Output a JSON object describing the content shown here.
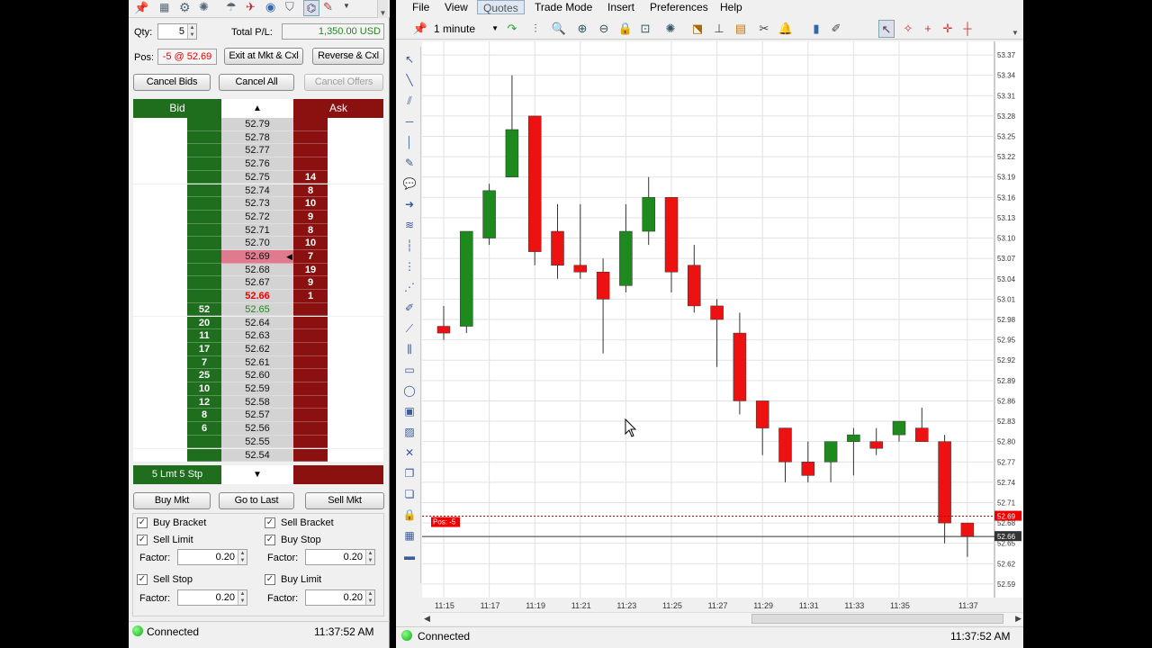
{
  "dom": {
    "qty_label": "Qty:",
    "qty_value": "5",
    "total_pl_label": "Total P/L:",
    "total_pl_value": "1,350.00 USD",
    "pos_label": "Pos:",
    "pos_value": "-5 @ 52.69",
    "btn_exit": "Exit at Mkt & Cxl",
    "btn_reverse": "Reverse & Cxl",
    "btn_cancel_bids": "Cancel Bids",
    "btn_cancel_all": "Cancel All",
    "btn_cancel_offers": "Cancel Offers",
    "hdr_bid": "Bid",
    "hdr_ask": "Ask",
    "footer_bid": "5 Lmt 5 Stp",
    "btn_buy_mkt": "Buy Mkt",
    "btn_go_last": "Go to Last",
    "btn_sell_mkt": "Sell Mkt",
    "opt_buy_bracket": "Buy Bracket",
    "opt_sell_limit": "Sell Limit",
    "opt_sell_bracket": "Sell Bracket",
    "opt_buy_stop": "Buy Stop",
    "opt_sell_stop": "Sell Stop",
    "opt_buy_limit": "Buy Limit",
    "factor_label": "Factor:",
    "factor_value": "0.20",
    "status": "Connected",
    "time": "11:37:52 AM",
    "rows": [
      {
        "price": "52.79",
        "bid": "",
        "ask": ""
      },
      {
        "price": "52.78",
        "bid": "",
        "ask": ""
      },
      {
        "price": "52.77",
        "bid": "",
        "ask": ""
      },
      {
        "price": "52.76",
        "bid": "",
        "ask": ""
      },
      {
        "price": "52.75",
        "bid": "",
        "ask": "14"
      },
      {
        "price": "52.74",
        "bid": "",
        "ask": "8"
      },
      {
        "price": "52.73",
        "bid": "",
        "ask": "10"
      },
      {
        "price": "52.72",
        "bid": "",
        "ask": "9"
      },
      {
        "price": "52.71",
        "bid": "",
        "ask": "8"
      },
      {
        "price": "52.70",
        "bid": "",
        "ask": "10"
      },
      {
        "price": "52.69",
        "bid": "",
        "ask": "7",
        "pos": true
      },
      {
        "price": "52.68",
        "bid": "",
        "ask": "19"
      },
      {
        "price": "52.67",
        "bid": "",
        "ask": "9"
      },
      {
        "price": "52.66",
        "bid": "",
        "ask": "1",
        "last": "down"
      },
      {
        "price": "52.65",
        "bid": "52",
        "ask": "",
        "last": "up"
      },
      {
        "price": "52.64",
        "bid": "20",
        "ask": ""
      },
      {
        "price": "52.63",
        "bid": "11",
        "ask": ""
      },
      {
        "price": "52.62",
        "bid": "17",
        "ask": ""
      },
      {
        "price": "52.61",
        "bid": "7",
        "ask": ""
      },
      {
        "price": "52.60",
        "bid": "25",
        "ask": ""
      },
      {
        "price": "52.59",
        "bid": "10",
        "ask": ""
      },
      {
        "price": "52.58",
        "bid": "12",
        "ask": ""
      },
      {
        "price": "52.57",
        "bid": "8",
        "ask": ""
      },
      {
        "price": "52.56",
        "bid": "6",
        "ask": ""
      },
      {
        "price": "52.55",
        "bid": "",
        "ask": ""
      },
      {
        "price": "52.54",
        "bid": "",
        "ask": ""
      }
    ]
  },
  "chart": {
    "menu": [
      "File",
      "View",
      "Quotes",
      "Trade Mode",
      "Insert",
      "Preferences",
      "Help"
    ],
    "active_menu": "Quotes",
    "interval": "1 minute",
    "status": "Connected",
    "time": "11:37:52 AM",
    "pos_tag": "Pos: -5",
    "pos_price": "52.69",
    "last_price": "52.66"
  },
  "chart_data": {
    "type": "candlestick",
    "x_labels": [
      "11:15",
      "11:17",
      "11:19",
      "11:21",
      "11:23",
      "11:25",
      "11:27",
      "11:29",
      "11:31",
      "11:33",
      "11:35",
      "11:37"
    ],
    "y_ticks": [
      "53.37",
      "53.34",
      "53.31",
      "53.28",
      "53.25",
      "53.22",
      "53.19",
      "53.16",
      "53.13",
      "53.10",
      "53.07",
      "53.04",
      "53.01",
      "52.98",
      "52.95",
      "52.92",
      "52.89",
      "52.86",
      "52.83",
      "52.80",
      "52.77",
      "52.74",
      "52.71",
      "52.68",
      "52.65",
      "52.62",
      "52.59"
    ],
    "ylim": [
      52.57,
      53.39
    ],
    "candles": [
      {
        "t": "11:15",
        "o": 52.97,
        "h": 53.0,
        "l": 52.95,
        "c": 52.96
      },
      {
        "t": "11:16",
        "o": 52.97,
        "h": 53.1,
        "l": 52.96,
        "c": 53.11
      },
      {
        "t": "11:17",
        "o": 53.1,
        "h": 53.18,
        "l": 53.09,
        "c": 53.17
      },
      {
        "t": "11:17",
        "o": 53.19,
        "h": 53.34,
        "l": 53.19,
        "c": 53.26
      },
      {
        "t": "11:18",
        "o": 53.28,
        "h": 53.28,
        "l": 53.06,
        "c": 53.08
      },
      {
        "t": "11:19",
        "o": 53.11,
        "h": 53.15,
        "l": 53.04,
        "c": 53.06
      },
      {
        "t": "11:20",
        "o": 53.06,
        "h": 53.15,
        "l": 53.04,
        "c": 53.05
      },
      {
        "t": "11:21",
        "o": 53.05,
        "h": 53.07,
        "l": 52.93,
        "c": 53.01
      },
      {
        "t": "11:22",
        "o": 53.03,
        "h": 53.15,
        "l": 53.02,
        "c": 53.11
      },
      {
        "t": "11:23",
        "o": 53.11,
        "h": 53.19,
        "l": 53.09,
        "c": 53.16
      },
      {
        "t": "11:24",
        "o": 53.16,
        "h": 53.16,
        "l": 53.02,
        "c": 53.05
      },
      {
        "t": "11:25",
        "o": 53.06,
        "h": 53.09,
        "l": 52.99,
        "c": 53.0
      },
      {
        "t": "11:26",
        "o": 53.0,
        "h": 53.01,
        "l": 52.91,
        "c": 52.98
      },
      {
        "t": "11:27",
        "o": 52.96,
        "h": 52.99,
        "l": 52.84,
        "c": 52.86
      },
      {
        "t": "11:28",
        "o": 52.86,
        "h": 52.86,
        "l": 52.78,
        "c": 52.82
      },
      {
        "t": "11:29",
        "o": 52.82,
        "h": 52.82,
        "l": 52.74,
        "c": 52.77
      },
      {
        "t": "11:30",
        "o": 52.77,
        "h": 52.8,
        "l": 52.74,
        "c": 52.75
      },
      {
        "t": "11:31",
        "o": 52.77,
        "h": 52.8,
        "l": 52.74,
        "c": 52.8
      },
      {
        "t": "11:32",
        "o": 52.8,
        "h": 52.82,
        "l": 52.75,
        "c": 52.81
      },
      {
        "t": "11:33",
        "o": 52.8,
        "h": 52.82,
        "l": 52.78,
        "c": 52.79
      },
      {
        "t": "11:34",
        "o": 52.81,
        "h": 52.83,
        "l": 52.8,
        "c": 52.83
      },
      {
        "t": "11:35",
        "o": 52.82,
        "h": 52.85,
        "l": 52.8,
        "c": 52.8
      },
      {
        "t": "11:36",
        "o": 52.8,
        "h": 52.81,
        "l": 52.65,
        "c": 52.68
      },
      {
        "t": "11:37",
        "o": 52.68,
        "h": 52.68,
        "l": 52.63,
        "c": 52.66
      }
    ],
    "colors": {
      "up": "#1e8a1e",
      "down": "#ee1111",
      "pos_line": "#cc0000",
      "last_line": "#333333"
    }
  }
}
